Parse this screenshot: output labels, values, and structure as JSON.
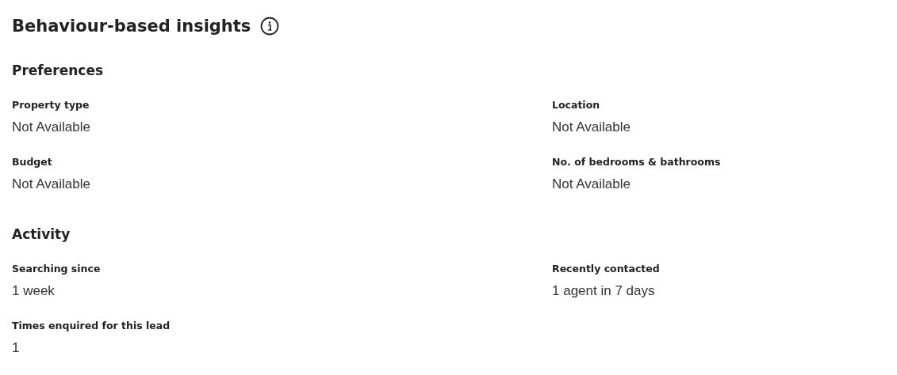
{
  "title": "Behaviour-based insights",
  "sections": [
    {
      "heading": "Preferences",
      "fields": [
        {
          "label": "Property type",
          "value": "Not Available"
        },
        {
          "label": "Location",
          "value": "Not Available"
        },
        {
          "label": "Budget",
          "value": "Not Available"
        },
        {
          "label": "No. of bedrooms & bathrooms",
          "value": "Not Available"
        }
      ]
    },
    {
      "heading": "Activity",
      "fields": [
        {
          "label": "Searching since",
          "value": "1 week"
        },
        {
          "label": "Recently contacted",
          "value": "1 agent in 7 days"
        },
        {
          "label": "Times enquired for this lead",
          "value": "1"
        }
      ]
    }
  ]
}
